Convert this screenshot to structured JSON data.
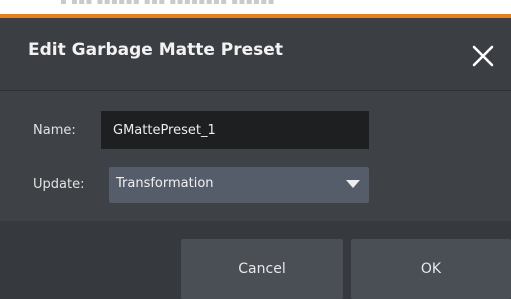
{
  "dialog": {
    "title": "Edit Garbage Matte Preset",
    "close_icon": "close-x-icon"
  },
  "form": {
    "name_label": "Name:",
    "name_value": "GMattePreset_1",
    "update_label": "Update:",
    "update_value": "Transformation",
    "dropdown_icon": "caret-down-icon"
  },
  "buttons": {
    "cancel": "Cancel",
    "ok": "OK"
  },
  "colors": {
    "accent": "#e6801e",
    "dialog_bg": "#3b3e43",
    "input_bg": "#1d1f21",
    "select_bg": "#565d6a",
    "button_bg": "#4a4e55"
  }
}
